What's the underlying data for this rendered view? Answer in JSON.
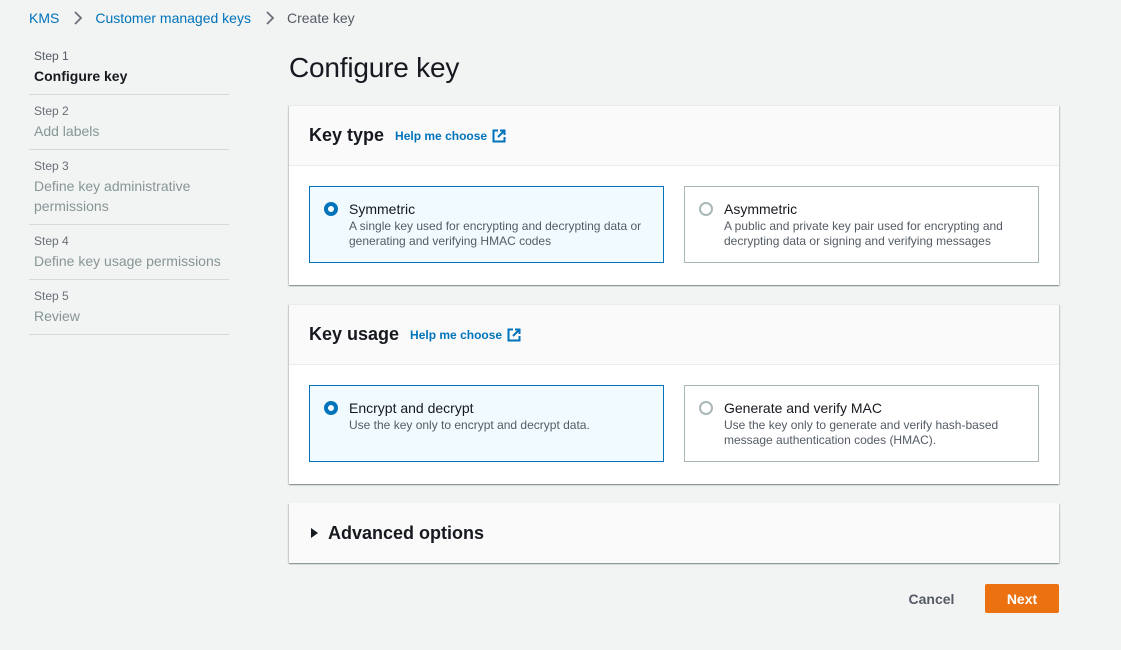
{
  "breadcrumb": {
    "items": [
      "KMS",
      "Customer managed keys"
    ],
    "current": "Create key"
  },
  "steps": [
    {
      "num": "Step 1",
      "label": "Configure key",
      "active": true
    },
    {
      "num": "Step 2",
      "label": "Add labels",
      "active": false
    },
    {
      "num": "Step 3",
      "label": "Define key administrative permissions",
      "active": false
    },
    {
      "num": "Step 4",
      "label": "Define key usage permissions",
      "active": false
    },
    {
      "num": "Step 5",
      "label": "Review",
      "active": false
    }
  ],
  "page": {
    "title": "Configure key"
  },
  "key_type": {
    "title": "Key type",
    "help": "Help me choose",
    "options": [
      {
        "title": "Symmetric",
        "desc": "A single key used for encrypting and decrypting data or generating and verifying HMAC codes",
        "selected": true
      },
      {
        "title": "Asymmetric",
        "desc": "A public and private key pair used for encrypting and decrypting data or signing and verifying messages",
        "selected": false
      }
    ]
  },
  "key_usage": {
    "title": "Key usage",
    "help": "Help me choose",
    "options": [
      {
        "title": "Encrypt and decrypt",
        "desc": "Use the key only to encrypt and decrypt data.",
        "selected": true
      },
      {
        "title": "Generate and verify MAC",
        "desc": "Use the key only to generate and verify hash-based message authentication codes (HMAC).",
        "selected": false
      }
    ]
  },
  "advanced": {
    "label": "Advanced options"
  },
  "actions": {
    "cancel": "Cancel",
    "next": "Next"
  },
  "colors": {
    "link": "#0073bb",
    "primary_button": "#ec7211",
    "selected_tile_bg": "#f1faff"
  }
}
